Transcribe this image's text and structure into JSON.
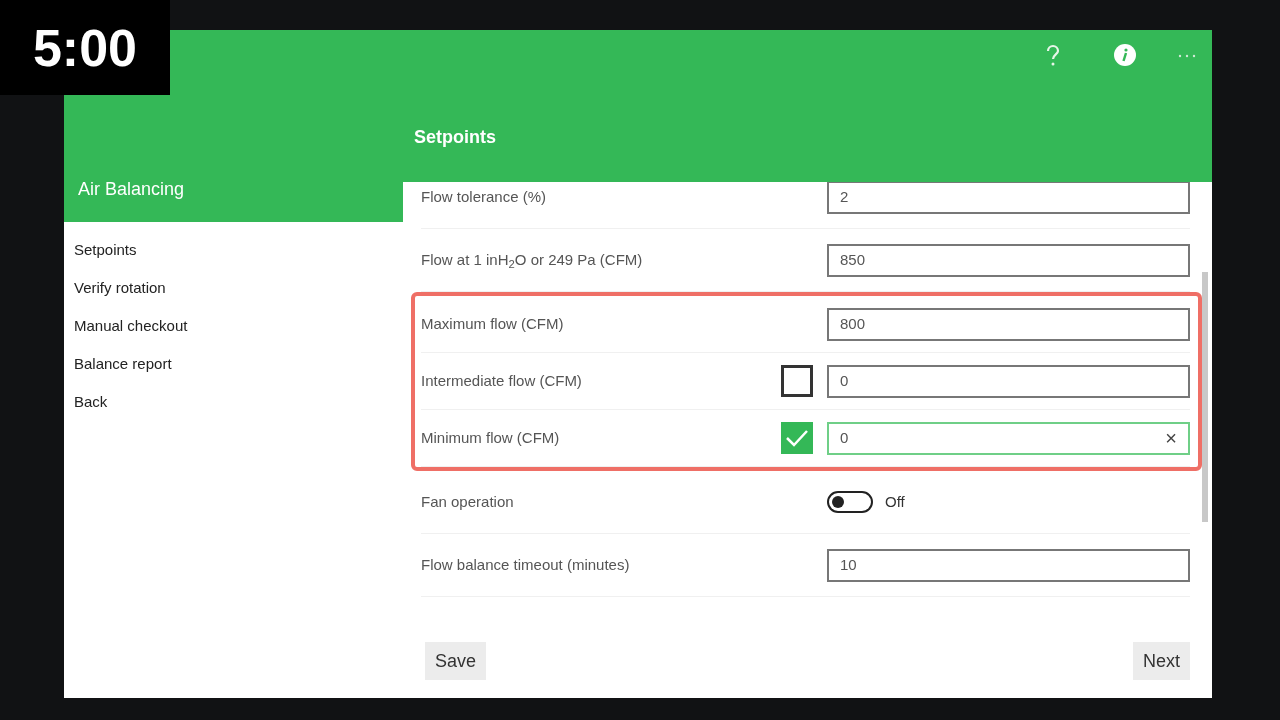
{
  "timer": "5:00",
  "header": {
    "title": "Setpoints"
  },
  "sidebar": {
    "title": "Air Balancing",
    "items": [
      {
        "label": "Setpoints"
      },
      {
        "label": "Verify rotation"
      },
      {
        "label": "Manual checkout"
      },
      {
        "label": "Balance report"
      },
      {
        "label": "Back"
      }
    ]
  },
  "rows": [
    {
      "kind": "field",
      "label": "Flow tolerance (%)",
      "value": "2",
      "highlighted": false
    },
    {
      "kind": "field",
      "label": "Flow at 1 inH$_{2}$O or 249 Pa (CFM)",
      "value": "850",
      "highlighted": false
    },
    {
      "kind": "field",
      "label": "Maximum flow (CFM)",
      "value": "800",
      "highlighted": true
    },
    {
      "kind": "field",
      "label": "Intermediate flow (CFM)",
      "value": "0",
      "highlighted": true,
      "checkbox": {
        "checked": false
      }
    },
    {
      "kind": "field",
      "label": "Minimum flow (CFM)",
      "value": "0",
      "highlighted": true,
      "focused": true,
      "clear_button": "×",
      "checkbox": {
        "checked": true
      }
    },
    {
      "kind": "toggle",
      "label": "Fan operation",
      "on": false,
      "state_label": "Off",
      "highlighted": false
    },
    {
      "kind": "field",
      "label": "Flow balance timeout (minutes)",
      "value": "10",
      "highlighted": false
    }
  ],
  "buttons": [
    {
      "label": "Save"
    },
    {
      "label": "Next"
    }
  ]
}
